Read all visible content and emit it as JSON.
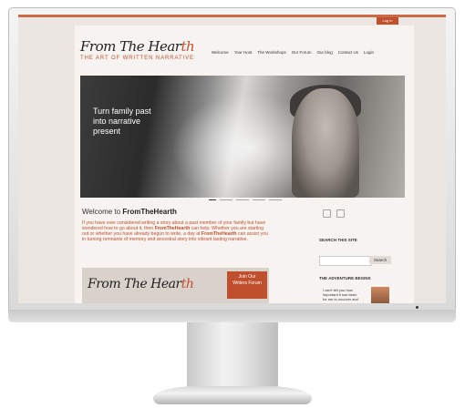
{
  "site": {
    "logo_main": "From The Hear",
    "logo_accent": "th",
    "tagline": "THE ART OF WRITTEN NARRATIVE",
    "login_tab": "Log in"
  },
  "nav": {
    "items": [
      "Welcome",
      "Your Host",
      "The Workshops",
      "Our Forum",
      "Our blog",
      "Contact Us",
      "Login"
    ]
  },
  "hero": {
    "text": "Turn family past into narrative present"
  },
  "content": {
    "welcome_prefix": "Welcome to ",
    "welcome_brand": "FromTheHearth",
    "intro_1": "If you have ever considered writing a story about a past member of your family but have wondered how to go about it, then ",
    "intro_brand_1": "FromTheHearth",
    "intro_2": " can help. Whether you are starting out or whether you have already begun to write, a day at ",
    "intro_brand_2": "FromTheHearth",
    "intro_3": " can assist you in turning remnants of memory and ancestral story into vibrant lasting narrative.",
    "banner_logo_main": "From The Hear",
    "banner_logo_accent": "th",
    "join_line1": "Join Our",
    "join_line2": "Writers Forum"
  },
  "sidebar": {
    "search_title": "SEARCH THIS SITE",
    "search_placeholder": "",
    "search_button": "Search",
    "adventure_title": "THE ADVENTURE BEGINS",
    "adventure_text": "I can't tell you how important it has been for me to uncover and"
  },
  "colors": {
    "accent": "#c0502d",
    "screen_bg": "#ebe6e2",
    "page_bg": "#f7f3f0"
  }
}
